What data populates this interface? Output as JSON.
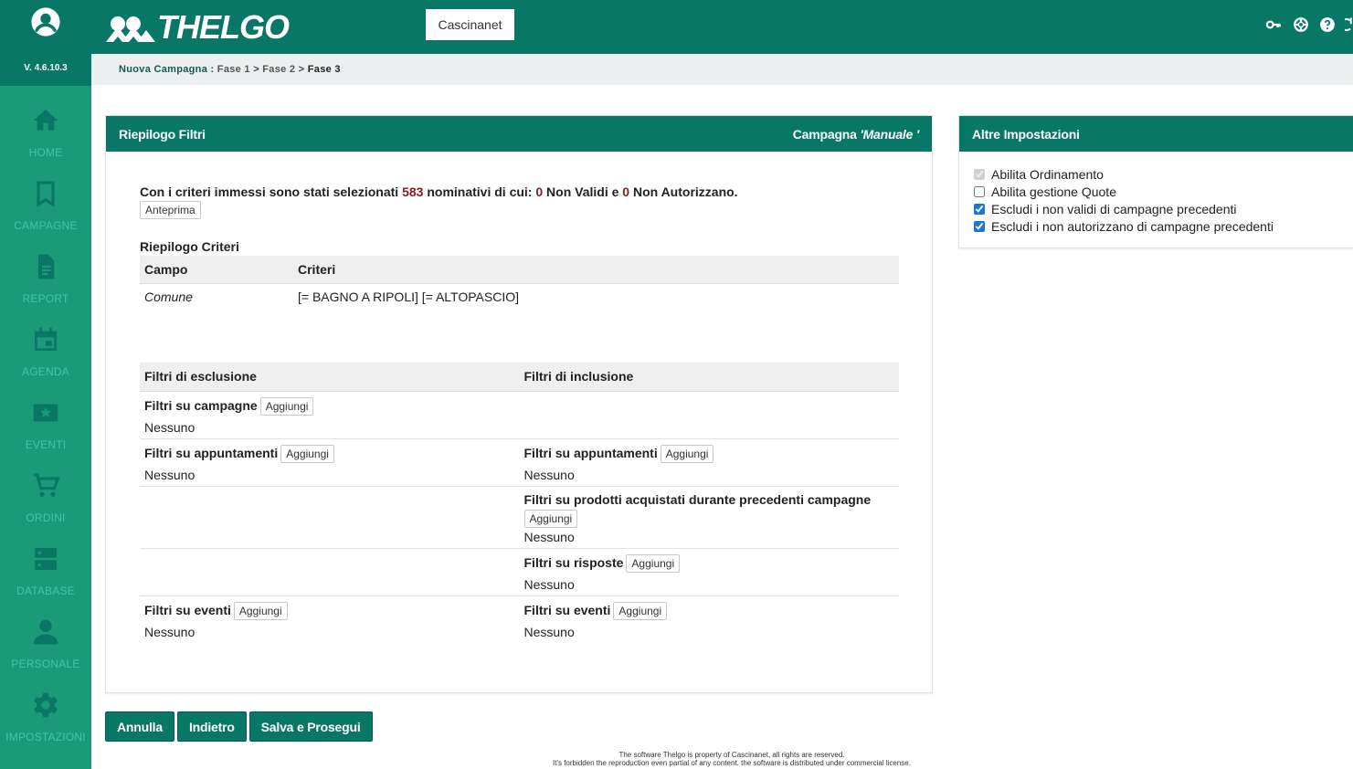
{
  "app": {
    "version": "V. 4.6.10.3",
    "logo_text": "THELGO",
    "tenant": "Cascinanet"
  },
  "colors": {
    "header": "#087766",
    "sidebar": "#1a9a76",
    "sidebar_label": "#3fc7a5",
    "accent_number": "#8b1a1a"
  },
  "sidebar": {
    "items": [
      {
        "label": "HOME",
        "icon": "home-icon"
      },
      {
        "label": "CAMPAGNE",
        "icon": "bookmark-icon"
      },
      {
        "label": "REPORT",
        "icon": "document-icon"
      },
      {
        "label": "AGENDA",
        "icon": "calendar-icon"
      },
      {
        "label": "EVENTI",
        "icon": "star-ticket-icon"
      },
      {
        "label": "ORDINI",
        "icon": "cart-icon"
      },
      {
        "label": "DATABASE",
        "icon": "database-icon"
      },
      {
        "label": "PERSONALE",
        "icon": "person-icon"
      },
      {
        "label": "IMPOSTAZIONI",
        "icon": "gear-icon"
      }
    ]
  },
  "header_icons": [
    "key-icon",
    "lifebuoy-icon",
    "help-icon",
    "power-icon"
  ],
  "breadcrumb": {
    "root": "Nuova Campagna",
    "colon": " : ",
    "step1": "Fase 1",
    "sep": " > ",
    "step2": "Fase 2",
    "step3": "Fase 3"
  },
  "main": {
    "title": "Riepilogo Filtri",
    "campaign_prefix": "Campagna ",
    "campaign_type": "'Manuale '",
    "summary": {
      "prefix": "Con i criteri immessi sono stati selezionati ",
      "selected": "583",
      "middle": " nominativi di cui: ",
      "invalid": "0",
      "invalid_label": " Non Validi e ",
      "unauthorized": "0",
      "unauthorized_label": " Non Autorizzano."
    },
    "preview_button": "Anteprima",
    "criteria_title": "Riepilogo Criteri",
    "criteria_headers": {
      "field": "Campo",
      "criteria": "Criteri"
    },
    "criteria_rows": [
      {
        "field": "Comune",
        "criteria": "[= BAGNO A RIPOLI]  [= ALTOPASCIO]"
      }
    ],
    "filters": {
      "header_exclusion": "Filtri di esclusione",
      "header_inclusion": "Filtri di inclusione",
      "add_label": "Aggiungi",
      "none_label": "Nessuno",
      "rows": [
        {
          "left": "Filtri su campagne",
          "right": ""
        },
        {
          "left": "Filtri su appuntamenti",
          "right": "Filtri su appuntamenti"
        },
        {
          "left": "",
          "right": "Filtri su prodotti acquistati durante precedenti campagne"
        },
        {
          "left": "",
          "right": "Filtri su risposte"
        },
        {
          "left": "Filtri su eventi",
          "right": "Filtri su eventi"
        }
      ]
    }
  },
  "side": {
    "title": "Altre Impostazioni",
    "options": [
      {
        "label": "Abilita Ordinamento",
        "checked": true,
        "disabled": true
      },
      {
        "label": "Abilita gestione Quote",
        "checked": false,
        "disabled": false
      },
      {
        "label": "Escludi i non validi di campagne precedenti",
        "checked": true,
        "disabled": false
      },
      {
        "label": "Escludi i non autorizzano di campagne precedenti",
        "checked": true,
        "disabled": false
      }
    ]
  },
  "actions": {
    "cancel": "Annulla",
    "back": "Indietro",
    "save": "Salva e Prosegui"
  },
  "footer": {
    "line1": "The software Thelgo is property of Cascinanet, all rights are reserved.",
    "line2": "It's forbidden the reproduction even partial of any content. the software is distributed under commercial license."
  }
}
